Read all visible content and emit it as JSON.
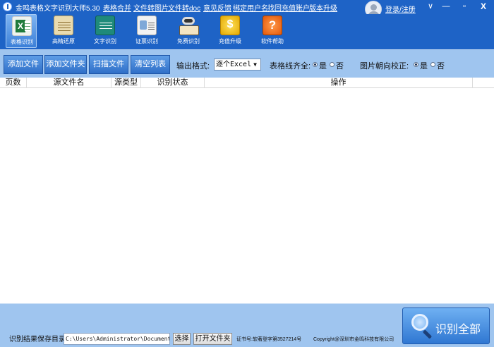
{
  "app": {
    "title": "金鸣表格文字识别大师5.30"
  },
  "top_links": [
    "表格合并",
    "文件转图片",
    "文件转doc",
    "意见反馈",
    "绑定用户名",
    "找回充值账户",
    "版本升级"
  ],
  "user": {
    "login_label": "登录/注册"
  },
  "window_controls": {
    "help": "∨",
    "minimize": "—",
    "restore": "▫",
    "close": "X"
  },
  "toolbar": [
    {
      "label": "表格识别",
      "icon": "excel-icon",
      "active": true
    },
    {
      "label": "高精还原",
      "icon": "document-icon",
      "active": false
    },
    {
      "label": "文字识别",
      "icon": "text-document-icon",
      "active": false
    },
    {
      "label": "证票识别",
      "icon": "certificate-icon",
      "active": false
    },
    {
      "label": "免费识别",
      "icon": "free-book-icon",
      "active": false
    },
    {
      "label": "充值升级",
      "icon": "coin-icon",
      "active": false
    },
    {
      "label": "软件帮助",
      "icon": "help-icon",
      "active": false
    }
  ],
  "actions": {
    "add_file": "添加文件",
    "add_folder": "添加文件夹",
    "scan_file": "扫描文件",
    "clear_list": "清空列表"
  },
  "options": {
    "output_format_label": "输出格式:",
    "output_format_value": "逐个Excel",
    "table_line_label": "表格线齐全:",
    "orientation_label": "图片朝向校正:",
    "yes": "是",
    "no": "否",
    "table_line_selected": "是",
    "orientation_selected": "是"
  },
  "table": {
    "columns": [
      "页数",
      "源文件名",
      "源类型",
      "识别状态",
      "操作"
    ],
    "rows": []
  },
  "footer": {
    "save_dir_label": "识别结果保存目录:",
    "save_dir_value": "C:\\Users\\Administrator\\Documents\\o",
    "select_button": "选择",
    "open_folder_button": "打开文件夹",
    "cert_no": "证书号:软著登字第3527214号",
    "copyright": "Copyright@深圳市金鸣科技有限公司",
    "recognize_all": "识别全部"
  },
  "colors": {
    "title_bar": "#1e63c6",
    "action_bar": "#9fc5ef",
    "button": "#3b7fd8"
  }
}
